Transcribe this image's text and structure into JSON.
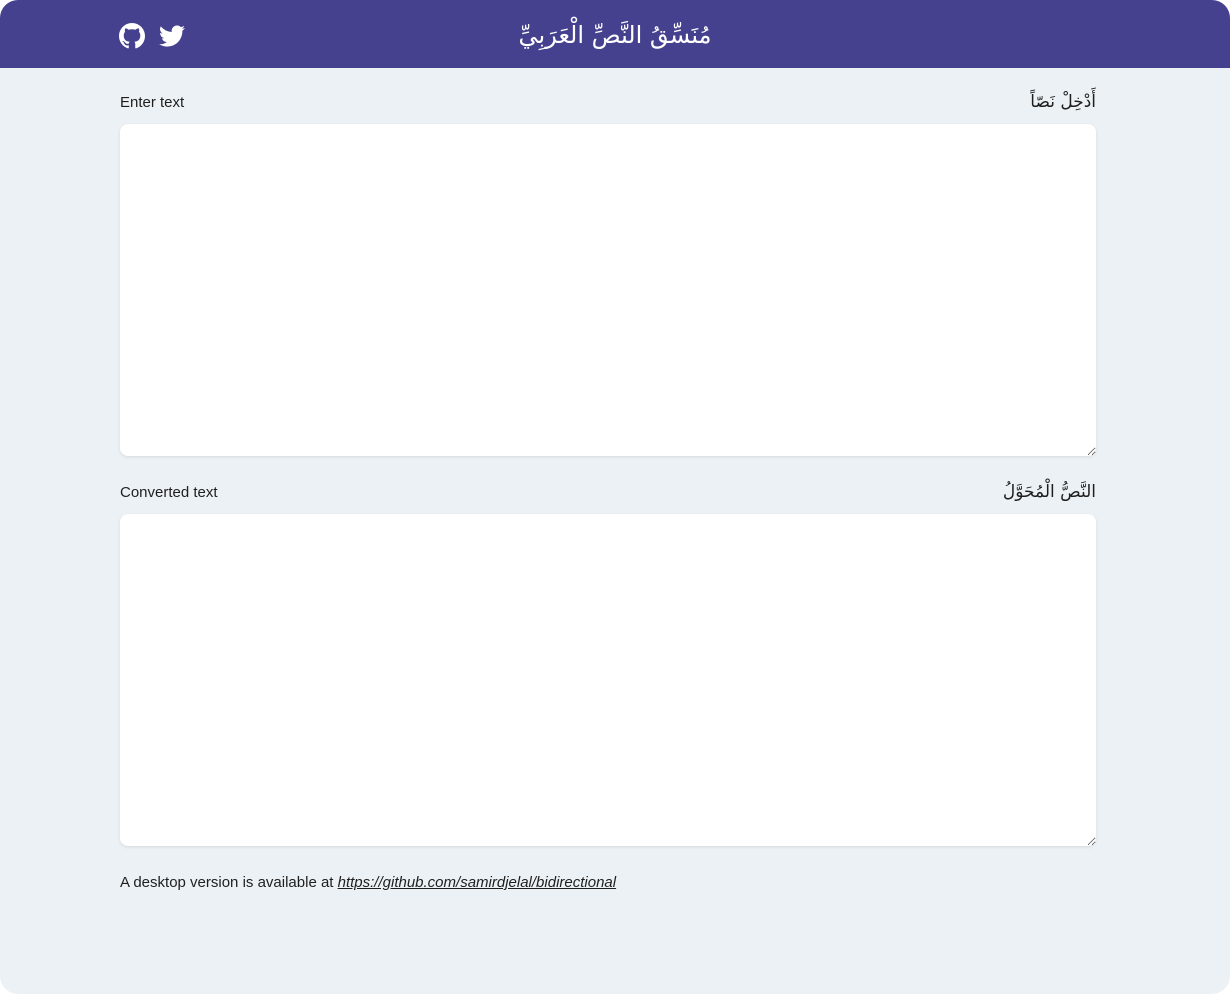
{
  "header": {
    "title": "مُنَسِّقُ النَّصِّ الْعَرَبِيِّ",
    "background_color": "#46418f",
    "icons": [
      "github-icon",
      "twitter-icon"
    ]
  },
  "input_section": {
    "label_en": "Enter text",
    "label_ar": "أَدْخِلْ نَصّاً",
    "value": ""
  },
  "output_section": {
    "label_en": "Converted text",
    "label_ar": "النَّصُّ الْمُحَوَّلُ",
    "value": ""
  },
  "footer": {
    "text": "A desktop version is available at ",
    "link_text": "https://github.com/samirdjelal/bidirectional"
  },
  "colors": {
    "page_background": "#ecf1f5",
    "header_background": "#46418f",
    "textarea_background": "#ffffff"
  }
}
